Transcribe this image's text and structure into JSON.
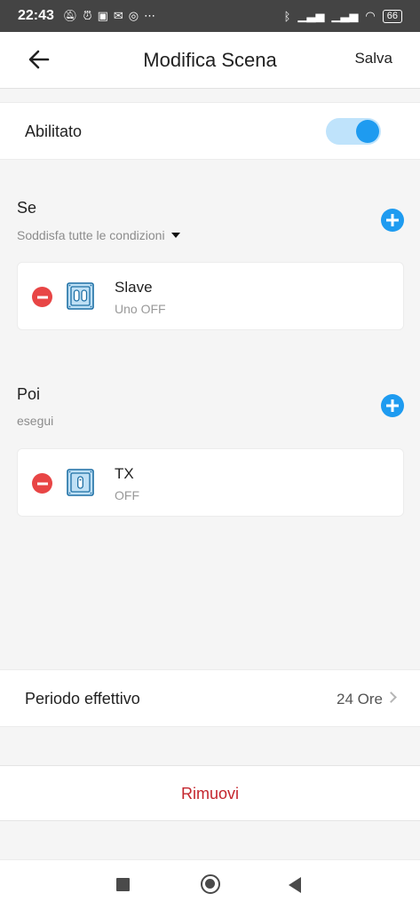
{
  "status_bar": {
    "time": "22:43",
    "battery": "66",
    "left_icons": [
      "mute-icon",
      "alarm-icon",
      "data-icon",
      "mail-icon",
      "instagram-icon",
      "more-icon"
    ],
    "right_icons": [
      "bluetooth-icon",
      "signal-icon",
      "signal-icon",
      "wifi-icon",
      "battery-icon"
    ]
  },
  "header": {
    "back_icon": "back-arrow-icon",
    "title": "Modifica Scena",
    "save_label": "Salva"
  },
  "enabled_row": {
    "label": "Abilitato",
    "toggle_on": true,
    "accent_color": "#1e9bf0"
  },
  "if_section": {
    "title": "Se",
    "subtitle": "Soddisfa tutte le condizioni",
    "conditions": [
      {
        "name": "Slave",
        "state": "Uno OFF",
        "icon": "dual-switch-icon"
      }
    ]
  },
  "then_section": {
    "title": "Poi",
    "subtitle": "esegui",
    "actions": [
      {
        "name": "TX",
        "state": "OFF",
        "icon": "single-switch-icon"
      }
    ]
  },
  "period_row": {
    "label": "Periodo effettivo",
    "value": "24 Ore"
  },
  "remove_row": {
    "label": "Rimuovi",
    "color": "#c4262e"
  },
  "nav_bar": {
    "icons": [
      "recents-icon",
      "home-icon",
      "back-icon"
    ]
  }
}
